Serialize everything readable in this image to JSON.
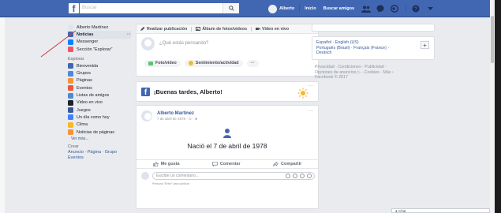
{
  "topbar": {
    "search_placeholder": "Buscar",
    "user_name": "Alberto",
    "home": "Inicio",
    "find_friends": "Buscar amigos"
  },
  "leftnav": {
    "profile": "Alberto Martínez",
    "items": [
      {
        "label": "Noticias",
        "icon": "news-feed-icon",
        "color": "#4267b2"
      },
      {
        "label": "Messenger",
        "icon": "messenger-icon",
        "color": "#0084ff"
      },
      {
        "label": "Sección \"Explorar\"",
        "icon": "explore-icon",
        "color": "#f35369"
      }
    ],
    "explore_heading": "Explorar",
    "explore_items": [
      {
        "label": "Bienvenida",
        "icon": "facebook-icon",
        "color": "#4267b2"
      },
      {
        "label": "Grupos",
        "icon": "groups-icon",
        "color": "#4c8ad6"
      },
      {
        "label": "Páginas",
        "icon": "pages-icon",
        "color": "#f7923b"
      },
      {
        "label": "Eventos",
        "icon": "events-icon",
        "color": "#e9573f"
      },
      {
        "label": "Listas de amigos",
        "icon": "friend-lists-icon",
        "color": "#4c8ad6"
      },
      {
        "label": "Video en vivo",
        "icon": "live-video-icon",
        "color": "#1d2129"
      },
      {
        "label": "Juegos",
        "icon": "games-icon",
        "color": "#3b5998"
      },
      {
        "label": "Un día como hoy",
        "icon": "on-this-day-icon",
        "color": "#4080ff"
      },
      {
        "label": "Clima",
        "icon": "weather-icon",
        "color": "#f7b928"
      },
      {
        "label": "Noticias de páginas",
        "icon": "pages-feed-icon",
        "color": "#f7923b"
      }
    ],
    "see_more": "Ver más...",
    "create_heading": "Crear",
    "create_links": "Anuncio · Página · Grupo",
    "create_events": "Eventos"
  },
  "composer": {
    "tab_post": "Realizar publicación",
    "tab_album": "Álbum de fotos/videos",
    "tab_live": "Video en vivo",
    "placeholder": "¿Qué estás pensando?",
    "photo": "Foto/video",
    "feeling": "Sentimiento/actividad",
    "more": "···"
  },
  "greeting": {
    "text": "¡Buenas tardes, Alberto!"
  },
  "post": {
    "author": "Alberto Martínez",
    "date": "7 de abril de 1978 · ⊙ · ⊕",
    "event_text": "Nació el 7 de abril de 1978",
    "like": "Me gusta",
    "comment": "Comentar",
    "share": "Compartir",
    "comment_placeholder": "Escribe un comentario...",
    "hint": "Presiona \"Enter\" para publicar."
  },
  "right": {
    "languages": "Español · English (US)",
    "languages2": "Português (Brasil) · Français (France) ·",
    "languages3": "Deutsch",
    "footer1": "Privacidad · Condiciones · Publicidad ·",
    "footer2": "Opciones de anuncios ▷ · Cookies · Más ›",
    "footer3": "Facebook © 2017"
  },
  "chat": {
    "label": "● Chat"
  },
  "colors": {
    "brand": "#4267b2",
    "background": "#e9ebee",
    "link": "#365899",
    "annotation_line": "#d2343c"
  }
}
